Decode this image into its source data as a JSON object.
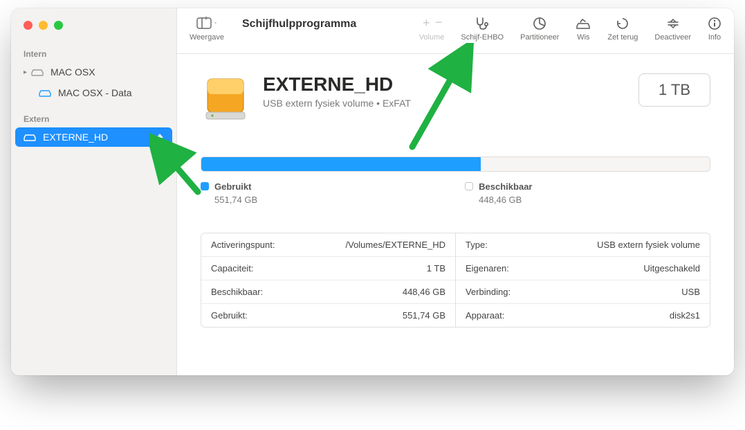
{
  "app_title": "Schijfhulpprogramma",
  "toolbar": {
    "view": "Weergave",
    "volume": "Volume",
    "firstaid": "Schijf-EHBO",
    "partition": "Partitioneer",
    "erase": "Wis",
    "restore": "Zet terug",
    "unmount": "Deactiveer",
    "info": "Info"
  },
  "sidebar": {
    "internal": {
      "label": "Intern",
      "items": [
        {
          "name": "MAC OSX"
        },
        {
          "name": "MAC OSX - Data"
        }
      ]
    },
    "external": {
      "label": "Extern",
      "items": [
        {
          "name": "EXTERNE_HD"
        }
      ]
    }
  },
  "volume": {
    "name": "EXTERNE_HD",
    "subtitle": "USB extern fysiek volume • ExFAT",
    "capacity_box": "1 TB"
  },
  "usage": {
    "used_label": "Gebruikt",
    "used_value": "551,74 GB",
    "free_label": "Beschikbaar",
    "free_value": "448,46 GB",
    "used_pct": 55
  },
  "info": {
    "left": [
      {
        "k": "Activeringspunt:",
        "v": "/Volumes/EXTERNE_HD"
      },
      {
        "k": "Capaciteit:",
        "v": "1 TB"
      },
      {
        "k": "Beschikbaar:",
        "v": "448,46 GB"
      },
      {
        "k": "Gebruikt:",
        "v": "551,74 GB"
      }
    ],
    "right": [
      {
        "k": "Type:",
        "v": "USB extern fysiek volume"
      },
      {
        "k": "Eigenaren:",
        "v": "Uitgeschakeld"
      },
      {
        "k": "Verbinding:",
        "v": "USB"
      },
      {
        "k": "Apparaat:",
        "v": "disk2s1"
      }
    ]
  }
}
